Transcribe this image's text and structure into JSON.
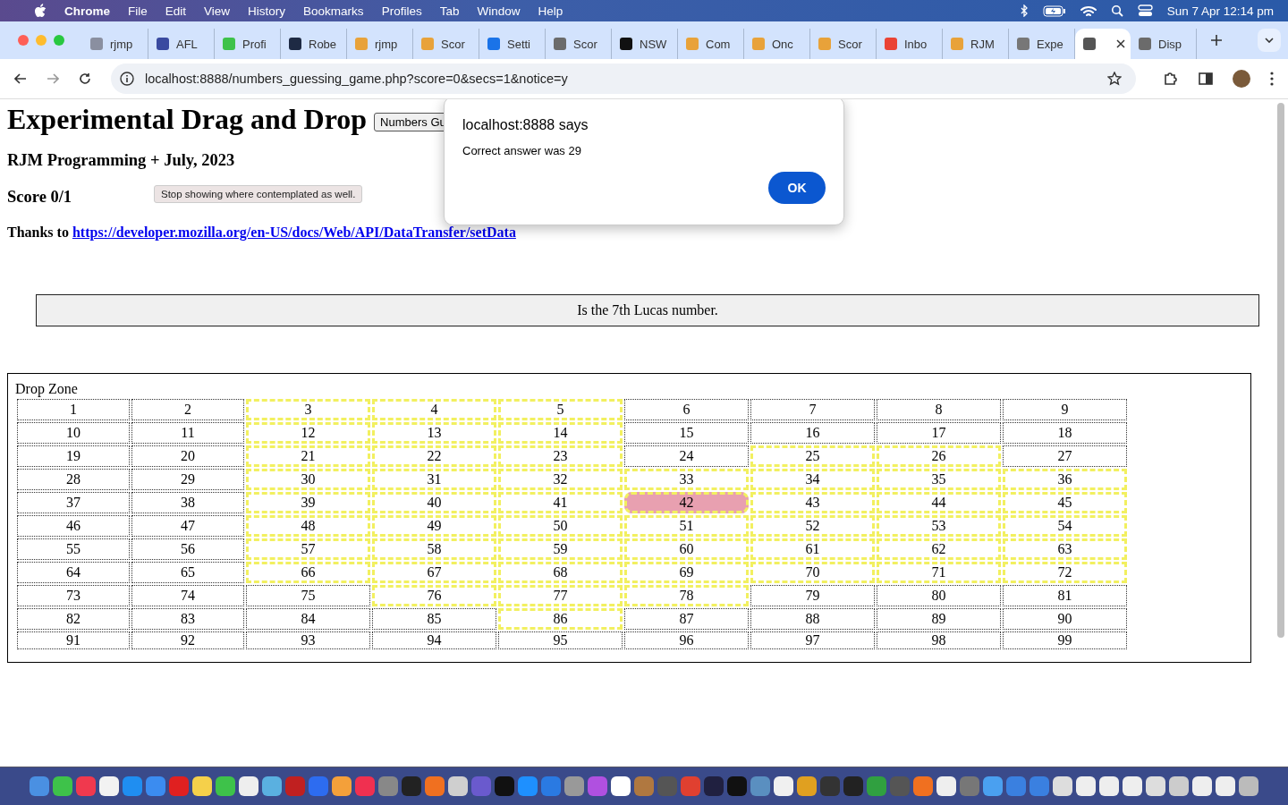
{
  "menu_bar": {
    "app": "Chrome",
    "items": [
      "File",
      "Edit",
      "View",
      "History",
      "Bookmarks",
      "Profiles",
      "Tab",
      "Window",
      "Help"
    ],
    "clock": "Sun 7 Apr  12:14 pm"
  },
  "tabs": [
    {
      "title": "rjmp",
      "selected": false
    },
    {
      "title": "AFL",
      "selected": false
    },
    {
      "title": "Profi",
      "selected": false
    },
    {
      "title": "Robe",
      "selected": false
    },
    {
      "title": "rjmp",
      "selected": false
    },
    {
      "title": "Scor",
      "selected": false
    },
    {
      "title": "Setti",
      "selected": false
    },
    {
      "title": "Scor",
      "selected": false
    },
    {
      "title": "NSW",
      "selected": false
    },
    {
      "title": "Com",
      "selected": false
    },
    {
      "title": "Onc",
      "selected": false
    },
    {
      "title": "Scor",
      "selected": false
    },
    {
      "title": "Inbo",
      "selected": false
    },
    {
      "title": "RJM",
      "selected": false
    },
    {
      "title": "Expe",
      "selected": false
    },
    {
      "selected": true
    },
    {
      "title": "Disp",
      "selected": false
    }
  ],
  "address": "localhost:8888/numbers_guessing_game.php?score=0&secs=1&notice=y",
  "page": {
    "heading": "Experimental Drag and Drop",
    "game_select": "Numbers Gu",
    "byline": "RJM Programming + July, 2023",
    "tooltip": "Stop showing where contemplated as well.",
    "score": "Score 0/1",
    "thanks": "Thanks to",
    "link": "https://developer.mozilla.org/en-US/docs/Web/API/DataTransfer/setData",
    "clue": "Is the 7th Lucas number.",
    "drop_zone": "Drop Zone"
  },
  "cells": [
    {
      "n": "1",
      "marked": false,
      "selected": false
    },
    {
      "n": "2",
      "marked": false,
      "selected": false
    },
    {
      "n": "3",
      "marked": true,
      "selected": false
    },
    {
      "n": "4",
      "marked": true,
      "selected": false
    },
    {
      "n": "5",
      "marked": true,
      "selected": false
    },
    {
      "n": "6",
      "marked": false,
      "selected": false
    },
    {
      "n": "7",
      "marked": false,
      "selected": false
    },
    {
      "n": "8",
      "marked": false,
      "selected": false
    },
    {
      "n": "9",
      "marked": false,
      "selected": false
    },
    {
      "n": "10",
      "marked": false,
      "selected": false
    },
    {
      "n": "11",
      "marked": false,
      "selected": false
    },
    {
      "n": "12",
      "marked": true,
      "selected": false
    },
    {
      "n": "13",
      "marked": true,
      "selected": false
    },
    {
      "n": "14",
      "marked": true,
      "selected": false
    },
    {
      "n": "15",
      "marked": false,
      "selected": false
    },
    {
      "n": "16",
      "marked": false,
      "selected": false
    },
    {
      "n": "17",
      "marked": false,
      "selected": false
    },
    {
      "n": "18",
      "marked": false,
      "selected": false
    },
    {
      "n": "19",
      "marked": false,
      "selected": false
    },
    {
      "n": "20",
      "marked": false,
      "selected": false
    },
    {
      "n": "21",
      "marked": true,
      "selected": false
    },
    {
      "n": "22",
      "marked": true,
      "selected": false
    },
    {
      "n": "23",
      "marked": true,
      "selected": false
    },
    {
      "n": "24",
      "marked": false,
      "selected": false
    },
    {
      "n": "25",
      "marked": true,
      "selected": false
    },
    {
      "n": "26",
      "marked": true,
      "selected": false
    },
    {
      "n": "27",
      "marked": false,
      "selected": false
    },
    {
      "n": "28",
      "marked": false,
      "selected": false
    },
    {
      "n": "29",
      "marked": false,
      "selected": false
    },
    {
      "n": "30",
      "marked": true,
      "selected": false
    },
    {
      "n": "31",
      "marked": true,
      "selected": false
    },
    {
      "n": "32",
      "marked": true,
      "selected": false
    },
    {
      "n": "33",
      "marked": true,
      "selected": false
    },
    {
      "n": "34",
      "marked": true,
      "selected": false
    },
    {
      "n": "35",
      "marked": true,
      "selected": false
    },
    {
      "n": "36",
      "marked": true,
      "selected": false
    },
    {
      "n": "37",
      "marked": false,
      "selected": false
    },
    {
      "n": "38",
      "marked": false,
      "selected": false
    },
    {
      "n": "39",
      "marked": true,
      "selected": false
    },
    {
      "n": "40",
      "marked": true,
      "selected": false
    },
    {
      "n": "41",
      "marked": true,
      "selected": false
    },
    {
      "n": "42",
      "marked": true,
      "selected": true
    },
    {
      "n": "43",
      "marked": true,
      "selected": false
    },
    {
      "n": "44",
      "marked": true,
      "selected": false
    },
    {
      "n": "45",
      "marked": true,
      "selected": false
    },
    {
      "n": "46",
      "marked": false,
      "selected": false
    },
    {
      "n": "47",
      "marked": false,
      "selected": false
    },
    {
      "n": "48",
      "marked": true,
      "selected": false
    },
    {
      "n": "49",
      "marked": true,
      "selected": false
    },
    {
      "n": "50",
      "marked": true,
      "selected": false
    },
    {
      "n": "51",
      "marked": true,
      "selected": false
    },
    {
      "n": "52",
      "marked": true,
      "selected": false
    },
    {
      "n": "53",
      "marked": true,
      "selected": false
    },
    {
      "n": "54",
      "marked": true,
      "selected": false
    },
    {
      "n": "55",
      "marked": false,
      "selected": false
    },
    {
      "n": "56",
      "marked": false,
      "selected": false
    },
    {
      "n": "57",
      "marked": true,
      "selected": false
    },
    {
      "n": "58",
      "marked": true,
      "selected": false
    },
    {
      "n": "59",
      "marked": true,
      "selected": false
    },
    {
      "n": "60",
      "marked": true,
      "selected": false
    },
    {
      "n": "61",
      "marked": true,
      "selected": false
    },
    {
      "n": "62",
      "marked": true,
      "selected": false
    },
    {
      "n": "63",
      "marked": true,
      "selected": false
    },
    {
      "n": "64",
      "marked": false,
      "selected": false
    },
    {
      "n": "65",
      "marked": false,
      "selected": false
    },
    {
      "n": "66",
      "marked": true,
      "selected": false
    },
    {
      "n": "67",
      "marked": true,
      "selected": false
    },
    {
      "n": "68",
      "marked": true,
      "selected": false
    },
    {
      "n": "69",
      "marked": true,
      "selected": false
    },
    {
      "n": "70",
      "marked": true,
      "selected": false
    },
    {
      "n": "71",
      "marked": true,
      "selected": false
    },
    {
      "n": "72",
      "marked": true,
      "selected": false
    },
    {
      "n": "73",
      "marked": false,
      "selected": false
    },
    {
      "n": "74",
      "marked": false,
      "selected": false
    },
    {
      "n": "75",
      "marked": false,
      "selected": false
    },
    {
      "n": "76",
      "marked": true,
      "selected": false
    },
    {
      "n": "77",
      "marked": true,
      "selected": false
    },
    {
      "n": "78",
      "marked": true,
      "selected": false
    },
    {
      "n": "79",
      "marked": false,
      "selected": false
    },
    {
      "n": "80",
      "marked": false,
      "selected": false
    },
    {
      "n": "81",
      "marked": false,
      "selected": false
    },
    {
      "n": "82",
      "marked": false,
      "selected": false
    },
    {
      "n": "83",
      "marked": false,
      "selected": false
    },
    {
      "n": "84",
      "marked": false,
      "selected": false
    },
    {
      "n": "85",
      "marked": false,
      "selected": false
    },
    {
      "n": "86",
      "marked": true,
      "selected": false
    },
    {
      "n": "87",
      "marked": false,
      "selected": false
    },
    {
      "n": "88",
      "marked": false,
      "selected": false
    },
    {
      "n": "89",
      "marked": false,
      "selected": false
    },
    {
      "n": "90",
      "marked": false,
      "selected": false
    },
    {
      "n": "91",
      "marked": false,
      "selected": false
    },
    {
      "n": "92",
      "marked": false,
      "selected": false
    },
    {
      "n": "93",
      "marked": false,
      "selected": false
    },
    {
      "n": "94",
      "marked": false,
      "selected": false
    },
    {
      "n": "95",
      "marked": false,
      "selected": false
    },
    {
      "n": "96",
      "marked": false,
      "selected": false
    },
    {
      "n": "97",
      "marked": false,
      "selected": false
    },
    {
      "n": "98",
      "marked": false,
      "selected": false
    },
    {
      "n": "99",
      "marked": false,
      "selected": false
    }
  ],
  "dialog": {
    "title": "localhost:8888 says",
    "message": "Correct answer was 29",
    "button": "OK"
  }
}
